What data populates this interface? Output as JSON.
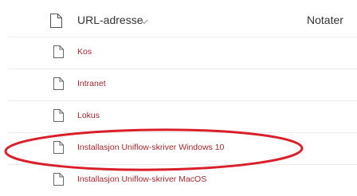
{
  "header": {
    "url_column": "URL-adresse",
    "notes_column": "Notater"
  },
  "rows": [
    {
      "label": "Kos"
    },
    {
      "label": "Intranet"
    },
    {
      "label": "Lokus"
    },
    {
      "label": "Installasjon Uniflow-skriver Windows 10"
    },
    {
      "label": "Installasjon Uniflow-skriver MacOS"
    }
  ],
  "icons": {
    "header": "file-icon",
    "row": "file-icon",
    "sort": "chevron-down-icon"
  },
  "colors": {
    "link": "#a4262c",
    "header_text": "#333333",
    "highlight": "#d9202a"
  }
}
